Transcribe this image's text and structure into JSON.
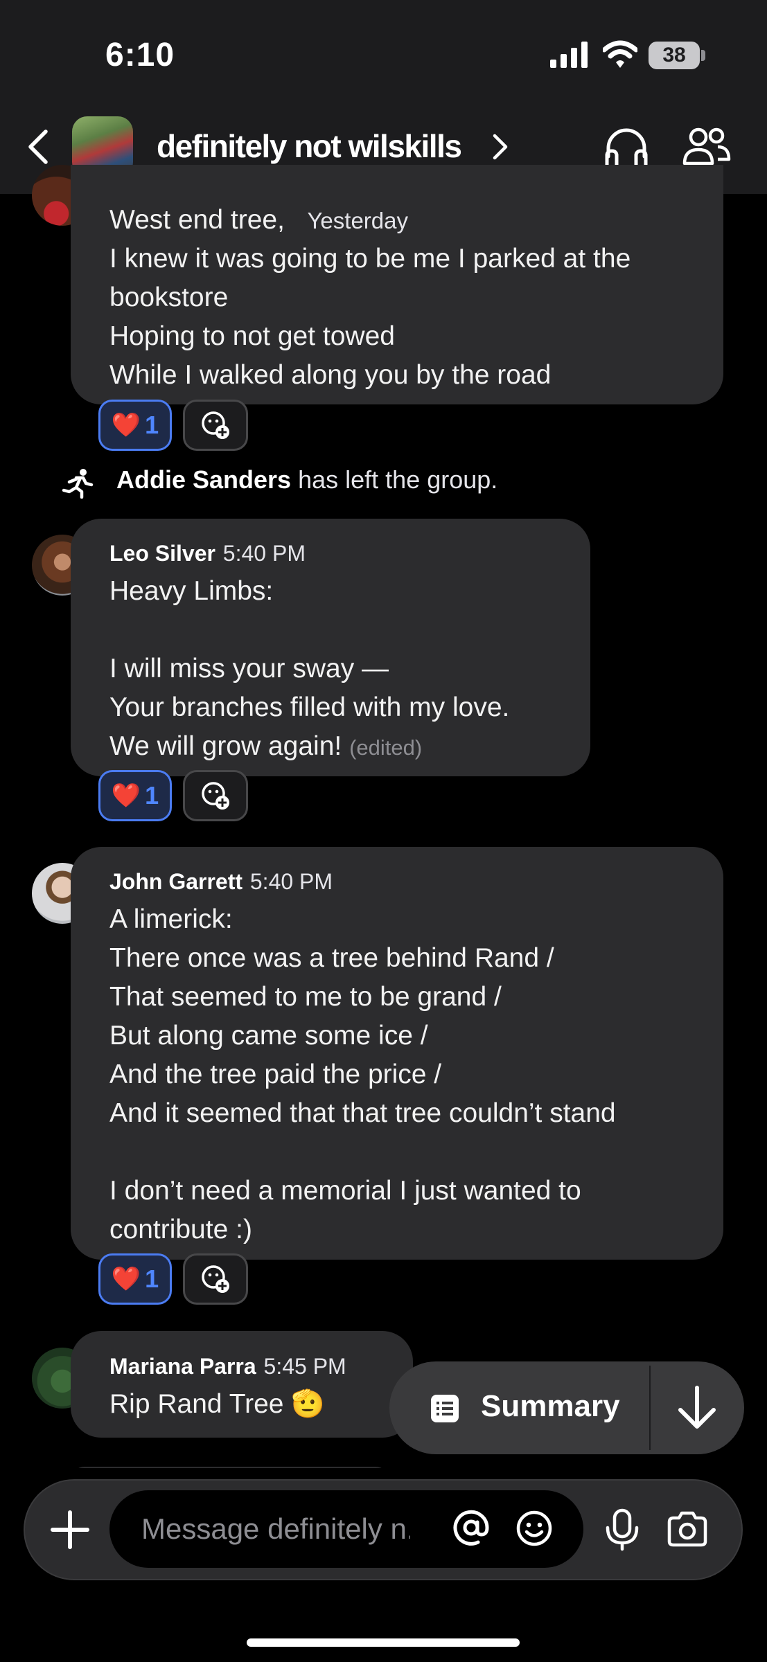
{
  "status_bar": {
    "time": "6:10",
    "battery": "38"
  },
  "header": {
    "group_name": "definitely not wilskills"
  },
  "messages": [
    {
      "lines": [
        "West end tree,",
        "I knew it was going to be me I parked at the",
        "bookstore",
        "Hoping to not get towed",
        "While I walked along you by the road"
      ],
      "timestamp": "Yesterday",
      "reaction": {
        "emoji": "❤️",
        "count": "1"
      }
    },
    {
      "sender": "Leo Silver",
      "time": "5:40 PM",
      "lines": [
        "Heavy Limbs:",
        "",
        "I will miss your sway —",
        "Your branches filled with my love.",
        "We will grow again!"
      ],
      "edited": "(edited)",
      "reaction": {
        "emoji": "❤️",
        "count": "1"
      }
    },
    {
      "sender": "John Garrett",
      "time": "5:40 PM",
      "lines": [
        "A limerick:",
        "There once was a tree behind Rand /",
        "That seemed to me to be grand /",
        "But along came some ice /",
        "And the tree paid the price /",
        "And it seemed that that tree couldn’t stand",
        "",
        "I don’t need a memorial I just wanted to",
        "contribute :)"
      ],
      "reaction": {
        "emoji": "❤️",
        "count": "1"
      }
    },
    {
      "sender": "Mariana Parra",
      "time": "5:45 PM",
      "text": "Rip Rand Tree 🫡"
    }
  ],
  "system_event": {
    "name": "Addie Sanders",
    "text": "has left the group."
  },
  "summary": {
    "label": "Summary"
  },
  "composer": {
    "placeholder": "Message definitely n..."
  }
}
